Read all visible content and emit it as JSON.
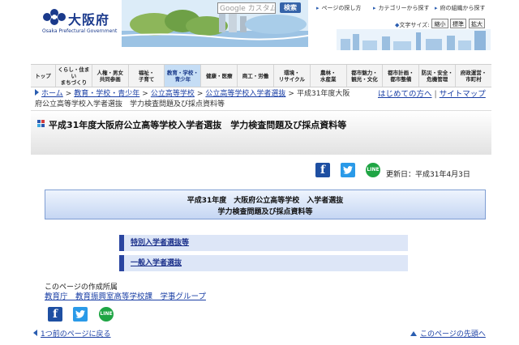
{
  "header": {
    "logo_text": "大阪府",
    "logo_sub": "Osaka Prefectural Government",
    "search_placeholder": "Google カスタム検",
    "search_button": "検索",
    "links": [
      "ページの探し方",
      "カテゴリーから探す",
      "府の組織から探す"
    ],
    "fontsize_label": "文字サイズ:",
    "fontsize_buttons": [
      "縮小",
      "標準",
      "拡大"
    ]
  },
  "nav": [
    {
      "label": "トップ"
    },
    {
      "label": "くらし・住まい\nまちづくり"
    },
    {
      "label": "人権・男女\n共同参画"
    },
    {
      "label": "福祉・\n子育て"
    },
    {
      "label": "教育・学校・\n青少年",
      "active": true
    },
    {
      "label": "健康・医療"
    },
    {
      "label": "商工・労働"
    },
    {
      "label": "環境・\nリサイクル"
    },
    {
      "label": "農林・\n水産業"
    },
    {
      "label": "都市魅力・\n観光・文化"
    },
    {
      "label": "都市計画・\n都市整備"
    },
    {
      "label": "防災・安全・\n危機管理"
    },
    {
      "label": "府政運営・\n市町村"
    }
  ],
  "breadcrumb": {
    "home": "ホーム",
    "level1": "教育・学校・青少年",
    "level2": "公立高等学校",
    "level3": "公立高等学校入学者選抜",
    "current_part1": "平成31年度大阪",
    "current_part2": "府公立高等学校入学者選抜　学力検査問題及び採点資料等",
    "separator": ">"
  },
  "help_links": {
    "first_visit": "はじめての方へ",
    "sitemap": "サイトマップ",
    "divider": "|"
  },
  "page": {
    "title": "平成31年度大阪府公立高等学校入学者選抜　学力検査問題及び採点資料等",
    "updated": "更新日：平成31年4月3日",
    "box_title_line1": "平成31年度　大阪府公立高等学校　入学者選抜",
    "box_title_line2": "学力検査問題及び採点資料等",
    "links": [
      "特別入学者選抜等",
      "一般入学者選抜"
    ],
    "org_label": "このページの作成所属",
    "org_link": "教育庁　教育振興室高等学校課　学事グループ"
  },
  "social": {
    "facebook": "f",
    "line": "LINE"
  },
  "footer": {
    "back": "1つ前のページに戻る",
    "top": "このページの先頭へ"
  },
  "colors": {
    "brand_blue": "#1b3a8c",
    "nav_active": "#c5ddf5",
    "link": "#1a3fa5",
    "facebook": "#1e4fa2",
    "twitter": "#2a9ae8",
    "line": "#1fa544"
  }
}
